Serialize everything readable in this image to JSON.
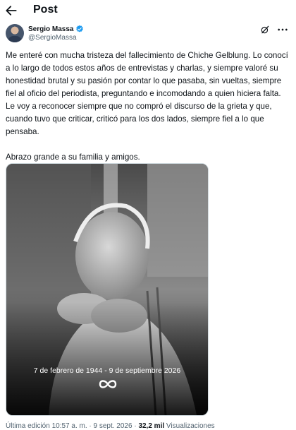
{
  "header": {
    "title": "Post"
  },
  "author": {
    "name": "Sergio Massa",
    "handle": "@SergioMassa"
  },
  "tweet": {
    "paragraph1": "Me enteré con mucha tristeza del fallecimiento de Chiche Gelblung. Lo conocí a lo largo de todos estos años de entrevistas y charlas, y siempre valoré su honestidad brutal y su pasión por contar lo que pasaba, sin vueltas, siempre fiel al oficio del periodista, preguntando e incomodando a quien hiciera falta. Le voy a reconocer siempre que no compró el discurso de la grieta y que, cuando tuvo que criticar, criticó para los dos lados, siempre fiel a lo que pensaba.",
    "paragraph2": "Abrazo grande a su familia y amigos."
  },
  "media": {
    "caption": "7 de febrero de 1944 - 9 de septiembre 2026"
  },
  "footer": {
    "edited": "Última edición 10:57 a. m. · 9 sept. 2026 · ",
    "views_count": "32,2 mil",
    "views_label": " Visualizaciones"
  },
  "colors": {
    "verified": "#1d9bf0",
    "text": "#0f1419",
    "secondary": "#536471"
  }
}
